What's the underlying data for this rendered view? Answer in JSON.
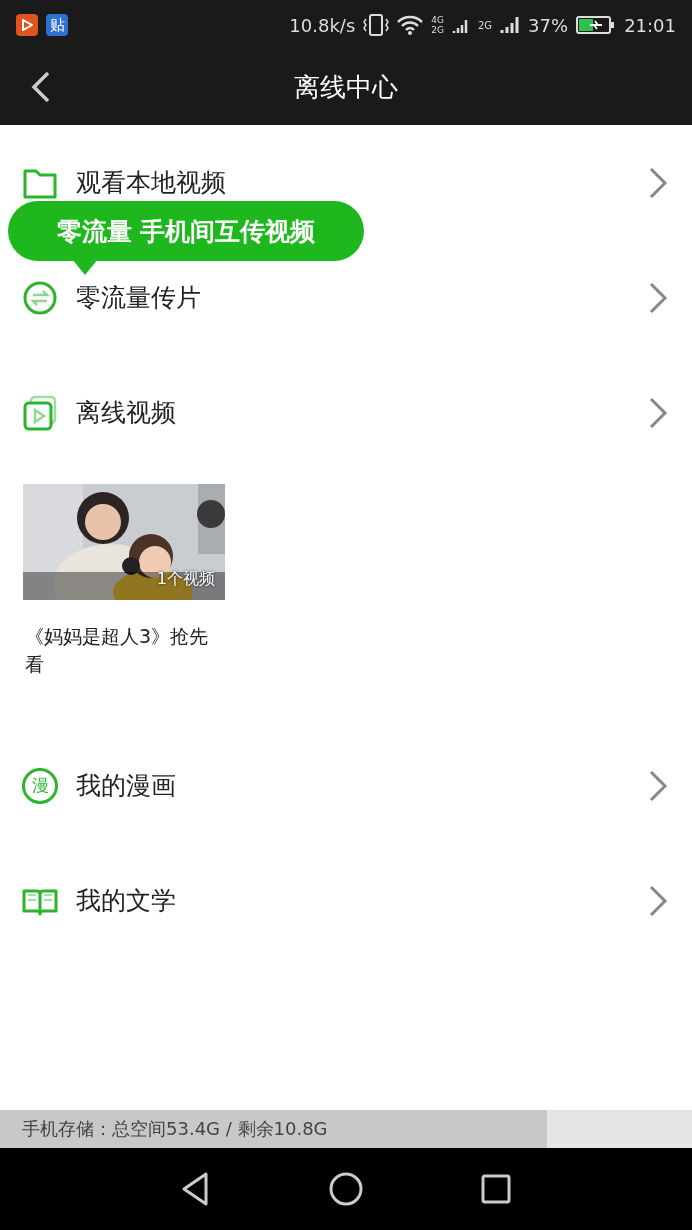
{
  "status_bar": {
    "notifications": [
      {
        "kind": "video"
      },
      {
        "kind": "tieba",
        "label": "贴"
      }
    ],
    "speed": "10.8k/s",
    "network_labels": [
      "4G",
      "2G"
    ],
    "signal_label": "2G",
    "battery_percent": "37%",
    "time": "21:01"
  },
  "header": {
    "title": "离线中心"
  },
  "menu": [
    {
      "kind": "folder",
      "label": "观看本地视频"
    },
    {
      "kind": "transfer",
      "label": "零流量传片"
    },
    {
      "kind": "video",
      "label": "离线视频"
    }
  ],
  "tooltip": "零流量 手机间互传视频",
  "offline_videos": [
    {
      "kind": "picture",
      "count": "1个视频",
      "title": "《妈妈是超人3》抢先看"
    }
  ],
  "menu_2": [
    {
      "kind": "comic",
      "icon_text": "漫",
      "label": "我的漫画"
    },
    {
      "kind": "book",
      "label": "我的文学"
    }
  ],
  "storage": {
    "text": "手机存储：总空间53.4G / 剩余10.8G",
    "level": 0.79
  }
}
